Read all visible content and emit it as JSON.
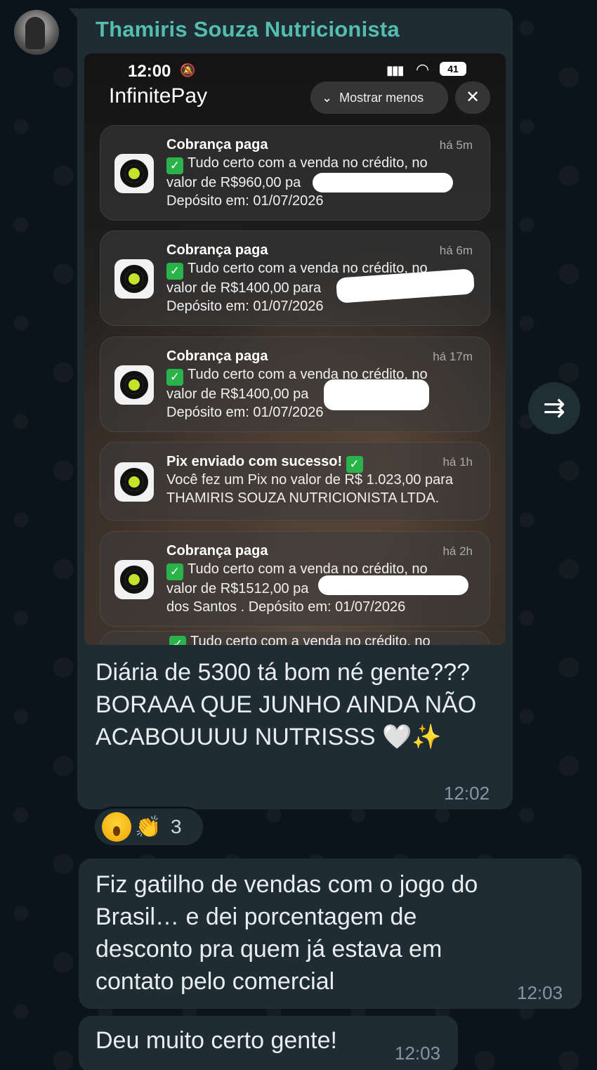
{
  "sender": "Thamiris Souza Nutricionista",
  "screenshot": {
    "status_time": "12:00",
    "battery": "41",
    "app_name": "InfinitePay",
    "show_less_label": "Mostrar menos",
    "notifications": [
      {
        "title": "Cobrança paga",
        "time": "há 5m",
        "line1": "Tudo certo com a venda no crédito, no",
        "line2": "valor de R$960,00 pa",
        "line3": "Depósito em: 01/07/2026"
      },
      {
        "title": "Cobrança paga",
        "time": "há 6m",
        "line1": "Tudo certo com a venda no crédito, no",
        "line2": "valor de R$1400,00 para",
        "line3": "Depósito em: 01/07/2026"
      },
      {
        "title": "Cobrança paga",
        "time": "há 17m",
        "line1": "Tudo certo com a venda no crédito, no",
        "line2": "valor de R$1400,00 pa",
        "line3": "Depósito em: 01/07/2026"
      },
      {
        "title": "Pix enviado com sucesso!",
        "time": "há 1h",
        "line1": "Você fez um Pix no valor de R$ 1.023,00 para",
        "line2": "THAMIRIS SOUZA NUTRICIONISTA LTDA."
      },
      {
        "title": "Cobrança paga",
        "time": "há 2h",
        "line1": "Tudo certo com a venda no crédito, no",
        "line2": "valor de R$1512,00 pa",
        "line3": "dos Santos . Depósito em: 01/07/2026"
      }
    ],
    "partial_line": "Tudo certo com a venda no crédito, no"
  },
  "messages": [
    {
      "text": "Diária de 5300 tá bom né gente??? BORAAA QUE JUNHO AINDA NÃO ACABOUUUU NUTRISSS 🤍✨",
      "time": "12:02"
    },
    {
      "text": "Fiz gatilho de vendas com o jogo do Brasil… e dei porcentagem de desconto pra quem já estava em contato pelo comercial",
      "time": "12:03"
    },
    {
      "text": "Deu muito certo gente!",
      "time": "12:03"
    }
  ],
  "reactions": {
    "emojis": [
      "😮",
      "👏"
    ],
    "count": "3"
  }
}
